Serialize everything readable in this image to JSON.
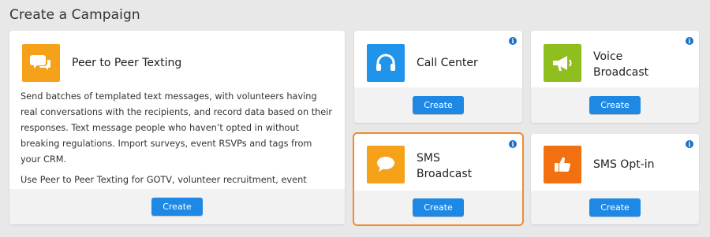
{
  "page": {
    "title": "Create a Campaign"
  },
  "colors": {
    "orange": "#f6a11a",
    "blue": "#1f94ea",
    "green": "#8ebf1f",
    "deep_orange": "#f2700f",
    "button": "#1e88e5",
    "selected_outline": "#f28a2e"
  },
  "cards": {
    "peer": {
      "title": "Peer to Peer Texting",
      "icon": "chat-bubbles-icon",
      "paragraph1": "Send batches of templated text messages, with volunteers having real conversations with the recipients, and record data based on their responses. Text message people who haven’t opted in without breaking regulations. Import surveys, event RSVPs and tags from your CRM.",
      "paragraph2": "Use Peer to Peer Texting for GOTV, volunteer recruitment, event invites, fundraising or supporter engagement.",
      "button": "Create"
    },
    "call_center": {
      "title": "Call Center",
      "icon": "headset-icon",
      "button": "Create"
    },
    "voice": {
      "title_line1": "Voice",
      "title_line2": "Broadcast",
      "icon": "megaphone-icon",
      "button": "Create"
    },
    "sms_broadcast": {
      "title_line1": "SMS",
      "title_line2": "Broadcast",
      "icon": "speech-bubble-icon",
      "button": "Create",
      "selected": true
    },
    "sms_optin": {
      "title": "SMS Opt-in",
      "icon": "thumbs-up-icon",
      "button": "Create"
    }
  },
  "info_glyph": "i"
}
